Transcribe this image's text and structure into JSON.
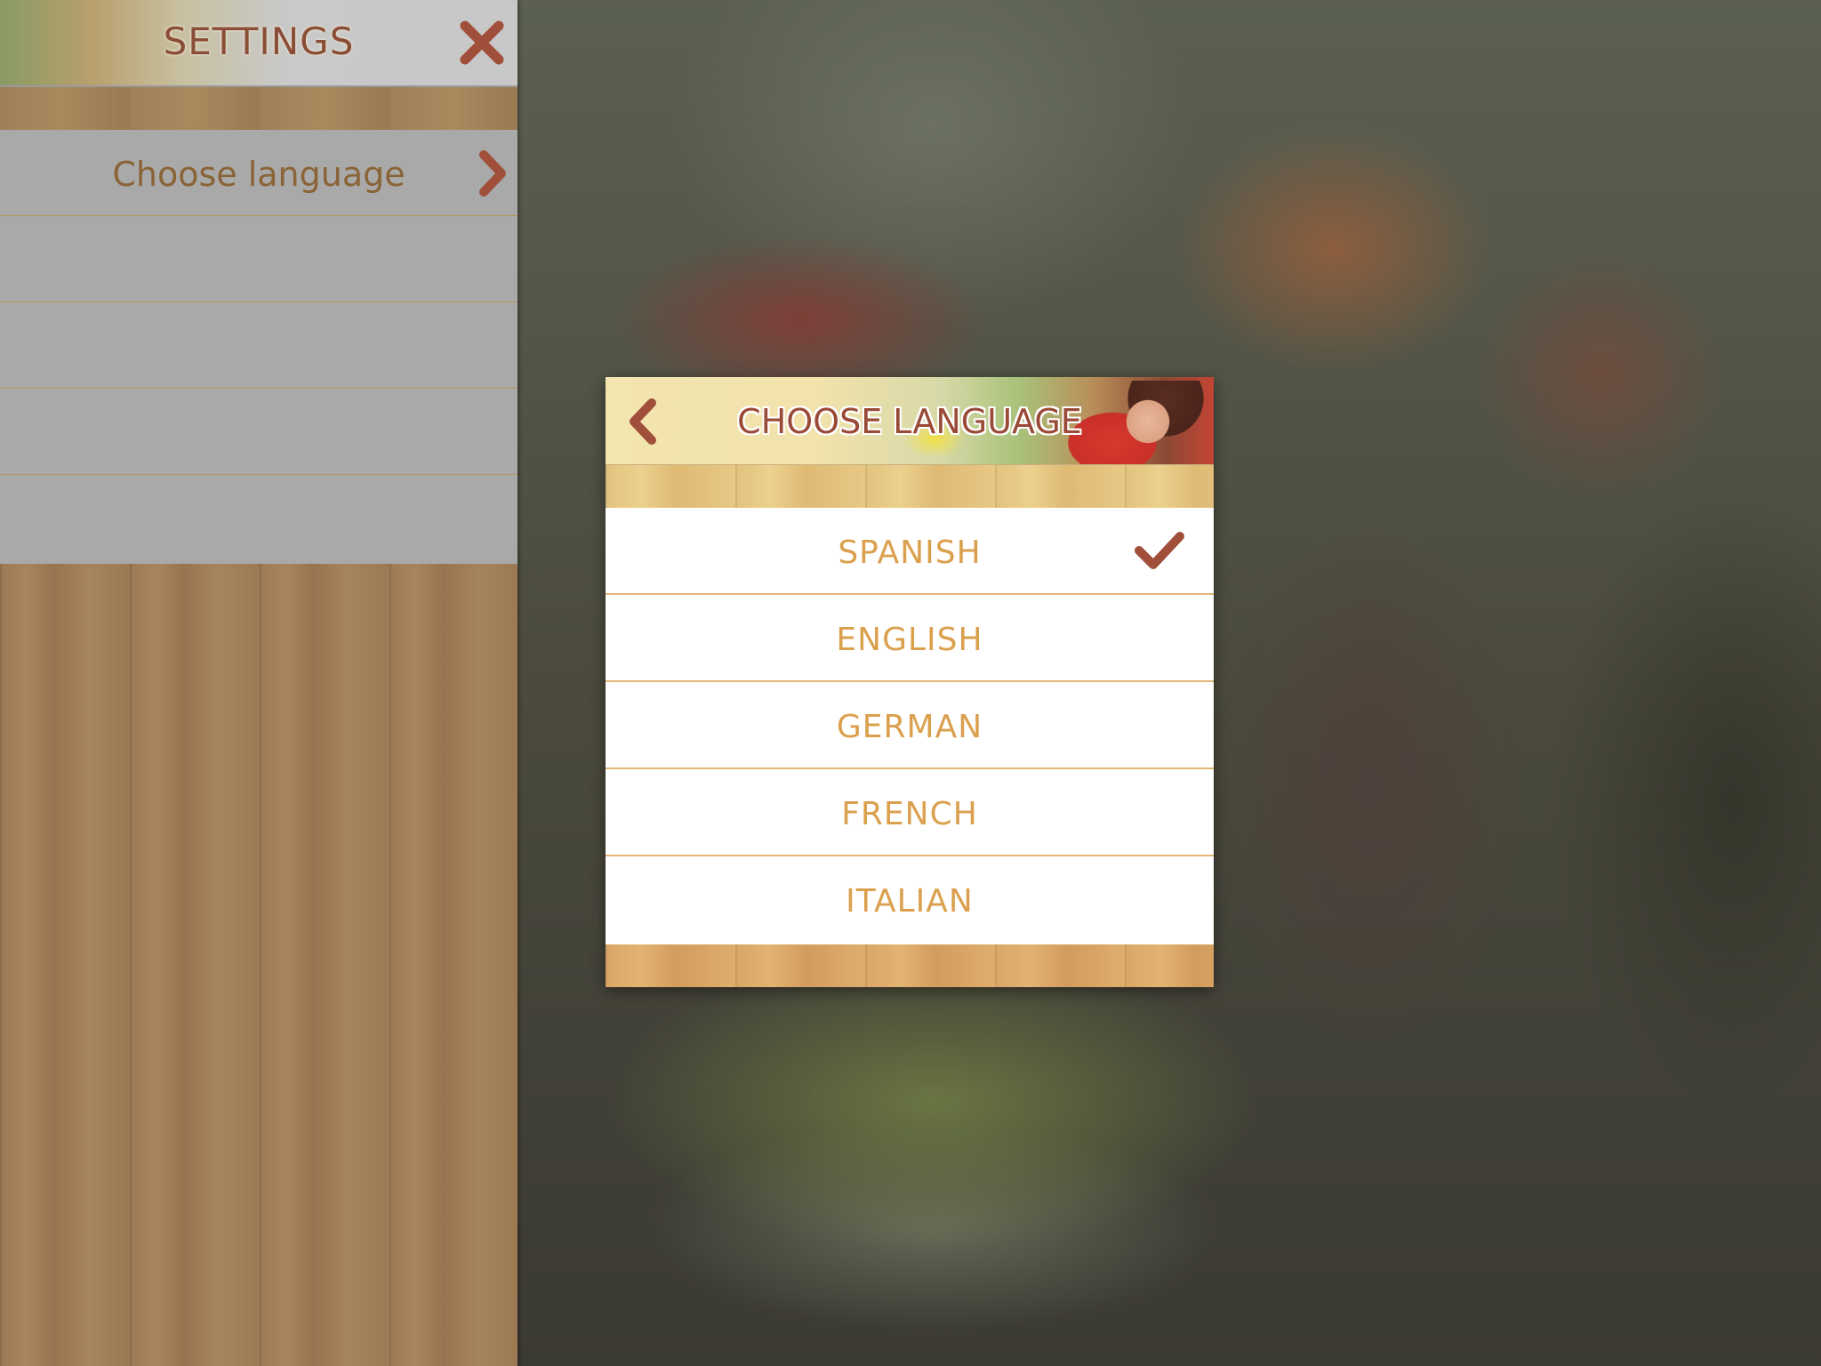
{
  "settings": {
    "title": "SETTINGS",
    "rows": [
      {
        "label": "Choose language"
      }
    ]
  },
  "modal": {
    "title": "CHOOSE LANGUAGE",
    "languages": [
      {
        "label": "SPANISH",
        "selected": true
      },
      {
        "label": "ENGLISH",
        "selected": false
      },
      {
        "label": "GERMAN",
        "selected": false
      },
      {
        "label": "FRENCH",
        "selected": false
      },
      {
        "label": "ITALIAN",
        "selected": false
      }
    ]
  },
  "colors": {
    "accent_brown": "#a0503a",
    "language_text": "#dba04e",
    "settings_text": "#8a6436"
  },
  "icons": {
    "close": "close-icon",
    "chevron": "chevron-right-icon",
    "back": "chevron-left-icon",
    "check": "check-icon"
  }
}
